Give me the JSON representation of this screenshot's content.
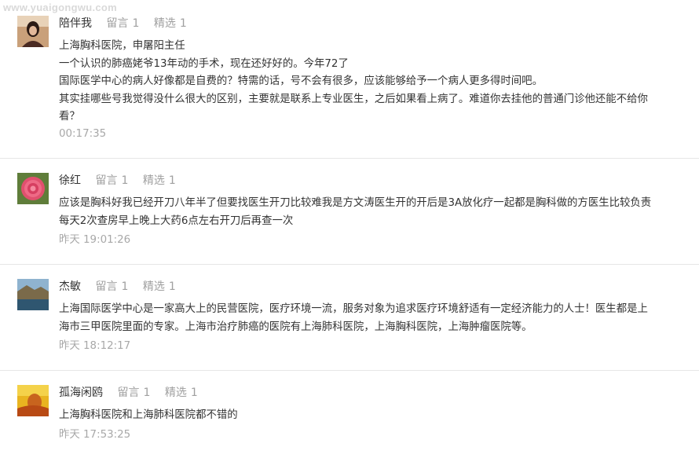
{
  "watermark": "www.yuaigongwu.com",
  "comments": [
    {
      "username": "陪伴我",
      "reply_label": "留言",
      "reply_count": "1",
      "featured_label": "精选",
      "featured_count": "1",
      "lines": [
        "上海胸科医院，申屠阳主任",
        "一个认识的肺癌姥爷13年动的手术，现在还好好的。今年72了",
        "国际医学中心的病人好像都是自费的？特需的话，号不会有很多，应该能够给予一个病人更多得时间吧。",
        "其实挂哪些号我觉得没什么很大的区别，主要就是联系上专业医生，之后如果看上病了。难道你去挂他的普通门诊他还能不给你",
        "看？"
      ],
      "time": "00:17:35"
    },
    {
      "username": "徐红",
      "reply_label": "留言",
      "reply_count": "1",
      "featured_label": "精选",
      "featured_count": "1",
      "lines": [
        "应该是胸科好我已经开刀八年半了但要找医生开刀比较难我是方文涛医生开的开后是3A放化疗一起都是胸科做的方医生比较负责",
        "每天2次查房早上晚上大药6点左右开刀后再查一次"
      ],
      "time": "昨天 19:01:26"
    },
    {
      "username": "杰敏",
      "reply_label": "留言",
      "reply_count": "1",
      "featured_label": "精选",
      "featured_count": "1",
      "lines": [
        "上海国际医学中心是一家高大上的民营医院，医疗环境一流，服务对象为追求医疗环境舒适有一定经济能力的人士！医生都是上",
        "海市三甲医院里面的专家。上海市治疗肺癌的医院有上海肺科医院，上海胸科医院，上海肿瘤医院等。"
      ],
      "time": "昨天 18:12:17"
    },
    {
      "username": "孤海闲鸥",
      "reply_label": "留言",
      "reply_count": "1",
      "featured_label": "精选",
      "featured_count": "1",
      "lines": [
        "上海胸科医院和上海肺科医院都不错的"
      ],
      "time": "昨天 17:53:25"
    }
  ]
}
